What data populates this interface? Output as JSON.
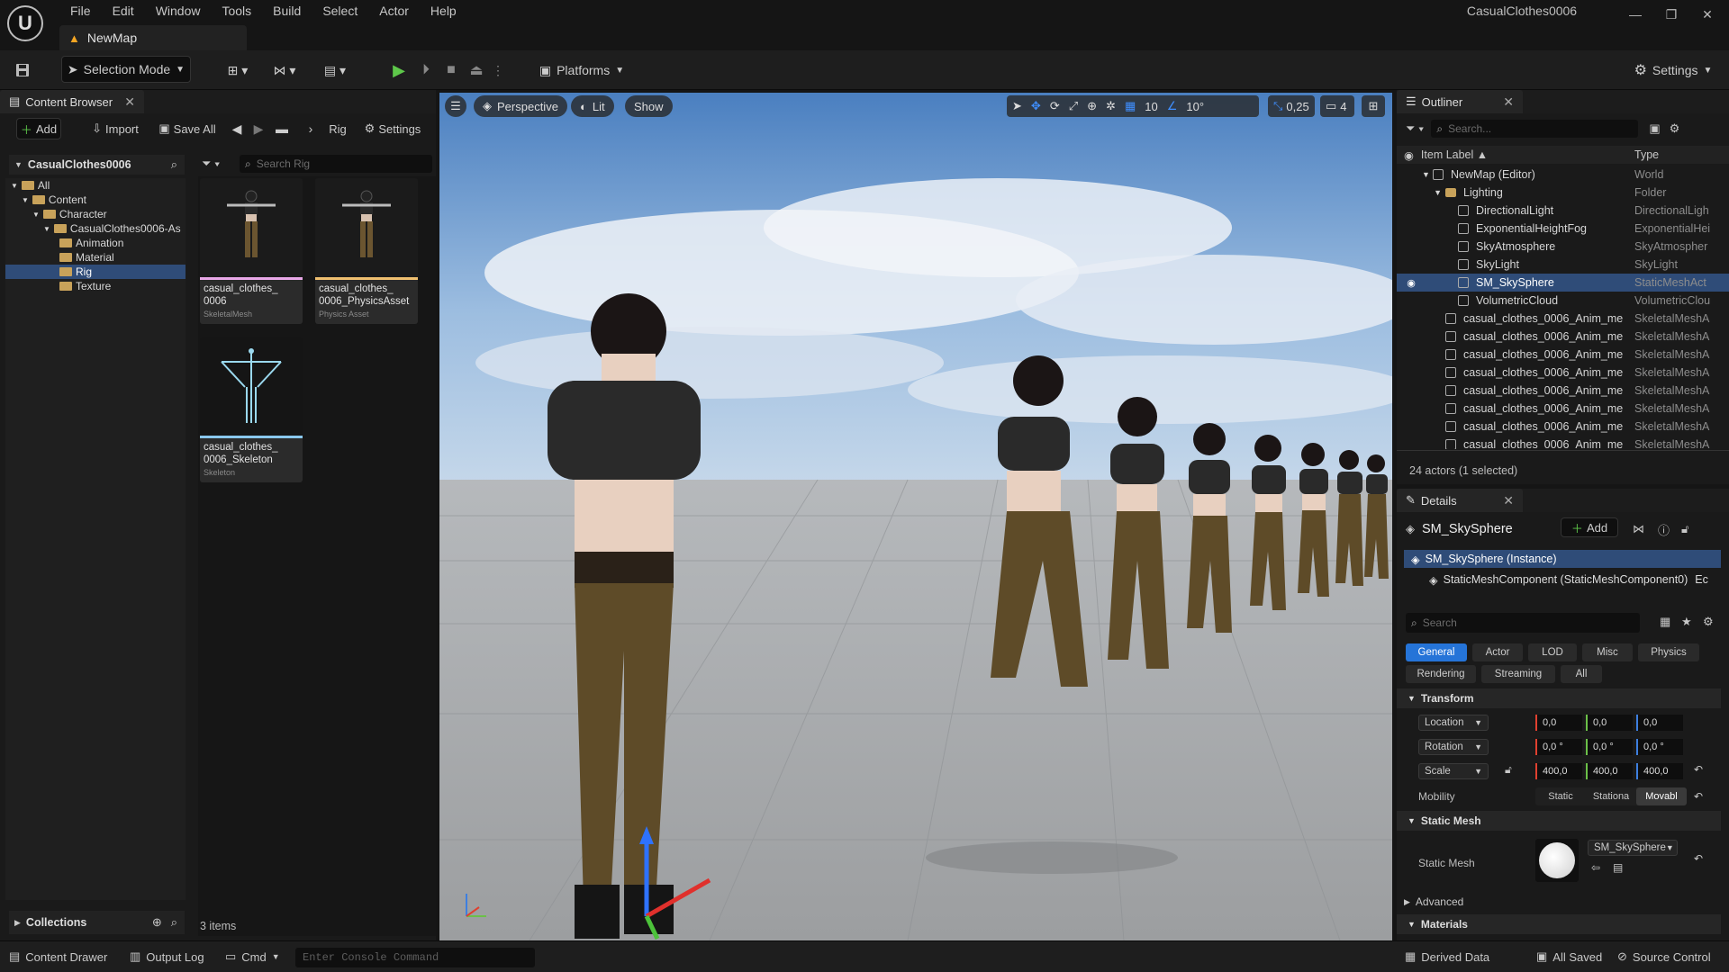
{
  "menu": [
    "File",
    "Edit",
    "Window",
    "Tools",
    "Build",
    "Select",
    "Actor",
    "Help"
  ],
  "project_name": "CasualClothes0006",
  "map_tab": "NewMap",
  "toolbar": {
    "selection_mode": "Selection Mode",
    "platforms": "Platforms",
    "settings": "Settings"
  },
  "content_browser": {
    "tab": "Content Browser",
    "add": "Add",
    "import": "Import",
    "save_all": "Save All",
    "breadcrumb": "Rig",
    "settings": "Settings",
    "root": "CasualClothes0006",
    "search_placeholder": "Search Rig",
    "tree": [
      "All",
      "Content",
      "Character",
      "CasualClothes0006-As",
      "Animation",
      "Material",
      "Rig",
      "Texture"
    ],
    "assets": [
      {
        "name": "casual_clothes_ 0006",
        "type": "SkeletalMesh",
        "color": "#e9a8e8"
      },
      {
        "name": "casual_clothes_ 0006_PhysicsAsset",
        "type": "Physics Asset",
        "color": "#f0c070"
      },
      {
        "name": "casual_clothes_ 0006_Skeleton",
        "type": "Skeleton",
        "color": "#8ac8ee"
      }
    ],
    "collections": "Collections",
    "items_count": "3 items"
  },
  "viewport": {
    "perspective": "Perspective",
    "lit": "Lit",
    "show": "Show",
    "grid_snap": "10",
    "rot_snap": "10°",
    "scale_snap": "0,25",
    "cam_speed": "4"
  },
  "outliner": {
    "tab": "Outliner",
    "search_placeholder": "Search...",
    "col_label": "Item Label ▲",
    "col_type": "Type",
    "rows": [
      {
        "label": "NewMap (Editor)",
        "type": "World",
        "indent": 0
      },
      {
        "label": "Lighting",
        "type": "Folder",
        "indent": 1
      },
      {
        "label": "DirectionalLight",
        "type": "DirectionalLigh",
        "indent": 2
      },
      {
        "label": "ExponentialHeightFog",
        "type": "ExponentialHei",
        "indent": 2
      },
      {
        "label": "SkyAtmosphere",
        "type": "SkyAtmospher",
        "indent": 2
      },
      {
        "label": "SkyLight",
        "type": "SkyLight",
        "indent": 2
      },
      {
        "label": "SM_SkySphere",
        "type": "StaticMeshAct",
        "indent": 2,
        "selected": true
      },
      {
        "label": "VolumetricCloud",
        "type": "VolumetricClou",
        "indent": 2
      },
      {
        "label": "casual_clothes_0006_Anim_me",
        "type": "SkeletalMeshA",
        "indent": 1
      },
      {
        "label": "casual_clothes_0006_Anim_me",
        "type": "SkeletalMeshA",
        "indent": 1
      },
      {
        "label": "casual_clothes_0006_Anim_me",
        "type": "SkeletalMeshA",
        "indent": 1
      },
      {
        "label": "casual_clothes_0006_Anim_me",
        "type": "SkeletalMeshA",
        "indent": 1
      },
      {
        "label": "casual_clothes_0006_Anim_me",
        "type": "SkeletalMeshA",
        "indent": 1
      },
      {
        "label": "casual_clothes_0006_Anim_me",
        "type": "SkeletalMeshA",
        "indent": 1
      },
      {
        "label": "casual_clothes_0006_Anim_me",
        "type": "SkeletalMeshA",
        "indent": 1
      },
      {
        "label": "casual_clothes_0006_Anim_me",
        "type": "SkeletalMeshA",
        "indent": 1
      }
    ],
    "footer": "24 actors (1 selected)"
  },
  "details": {
    "tab": "Details",
    "actor": "SM_SkySphere",
    "add": "Add",
    "instance": "SM_SkySphere (Instance)",
    "component": "StaticMeshComponent (StaticMeshComponent0)",
    "component_trunc": "Ec",
    "search_placeholder": "Search",
    "tabs": [
      "General",
      "Actor",
      "LOD",
      "Misc",
      "Physics",
      "Rendering",
      "Streaming",
      "All"
    ],
    "transform": "Transform",
    "location": {
      "label": "Location",
      "x": "0,0",
      "y": "0,0",
      "z": "0,0"
    },
    "rotation": {
      "label": "Rotation",
      "x": "0,0 °",
      "y": "0,0 °",
      "z": "0,0 °"
    },
    "scale": {
      "label": "Scale",
      "x": "400,0",
      "y": "400,0",
      "z": "400,0"
    },
    "mobility": {
      "label": "Mobility",
      "options": [
        "Static",
        "Stationa",
        "Movabl"
      ]
    },
    "static_mesh_section": "Static Mesh",
    "static_mesh_label": "Static Mesh",
    "static_mesh_value": "SM_SkySphere",
    "advanced": "Advanced",
    "materials": "Materials"
  },
  "status": {
    "content_drawer": "Content Drawer",
    "output_log": "Output Log",
    "cmd": "Cmd",
    "console_placeholder": "Enter Console Command",
    "derived_data": "Derived Data",
    "all_saved": "All Saved",
    "source_control": "Source Control"
  }
}
